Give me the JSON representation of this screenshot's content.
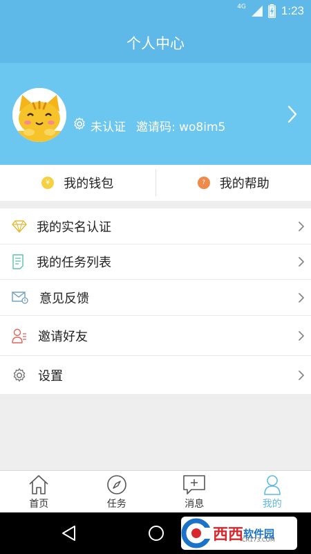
{
  "status_bar": {
    "network": "4G",
    "time": "1:23"
  },
  "header": {
    "title": "个人中心"
  },
  "profile": {
    "verify_status": "未认证",
    "invite_code": "邀请码: wo8im5"
  },
  "quick_actions": {
    "wallet_label": "我的钱包",
    "wallet_icon_glyph": "¥",
    "help_label": "我的帮助",
    "help_icon_glyph": "?",
    "colors": {
      "wallet": "#f5d142",
      "help": "#f08a4b"
    }
  },
  "menu": {
    "items": [
      {
        "label": "我的实名认证",
        "icon": "diamond-icon"
      },
      {
        "label": "我的任务列表",
        "icon": "task-list-icon"
      },
      {
        "label": "意见反馈",
        "icon": "feedback-envelope-icon"
      },
      {
        "label": "邀请好友",
        "icon": "invite-user-icon"
      },
      {
        "label": "设置",
        "icon": "settings-gear-icon"
      }
    ]
  },
  "tabbar": {
    "tabs": [
      {
        "label": "首页",
        "icon": "home-icon"
      },
      {
        "label": "任务",
        "icon": "compass-icon"
      },
      {
        "label": "消息",
        "icon": "message-icon"
      },
      {
        "label": "我的",
        "icon": "profile-icon",
        "active": true
      }
    ]
  },
  "watermark": {
    "text_red": "西西",
    "text_blue": "软件园",
    "sub": "CR173.COM"
  },
  "colors": {
    "primary": "#5eb8e8",
    "profile_bg": "#6bc6f0",
    "active_tab": "#5eb8e8"
  }
}
